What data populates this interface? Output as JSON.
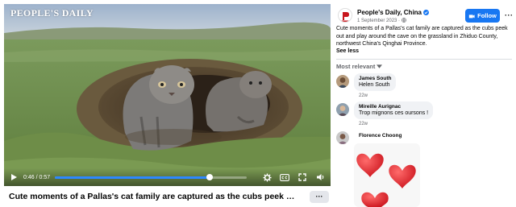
{
  "video": {
    "watermark": "PEOPLE'S DAILY",
    "time_current": "0:46",
    "time_total": "0:57",
    "time_separator": "/",
    "progress_fraction": 0.807,
    "title": "Cute moments of a Pallas's cat family are captured as the cubs peek out and ...",
    "more_label": "···"
  },
  "post": {
    "page_name": "People's Daily, China",
    "date": "1 September 2023 · ",
    "follow_label": "Follow",
    "menu_label": "···",
    "text": "Cute moments of a Pallas's cat family are captured as the cubs peek out and play around the cave on the grassland in Zhiduo County, northwest China's Qinghai Province.",
    "see_less": "See less",
    "brand_color": "#1877f2"
  },
  "comments_section": {
    "sort_label": "Most relevant",
    "comments": [
      {
        "author": "James South",
        "text": "Helen South",
        "time": "22w"
      },
      {
        "author": "Mireille Aurignac",
        "text": "Trop mignons ces oursons !",
        "time": "22w"
      },
      {
        "author": "Florence Choong",
        "text": "",
        "time": ""
      }
    ]
  },
  "icons": [
    "play-icon",
    "settings-icon",
    "captions-icon",
    "fullscreen-icon",
    "volume-icon",
    "verified-icon",
    "follow-icon",
    "chevron-down-icon"
  ]
}
